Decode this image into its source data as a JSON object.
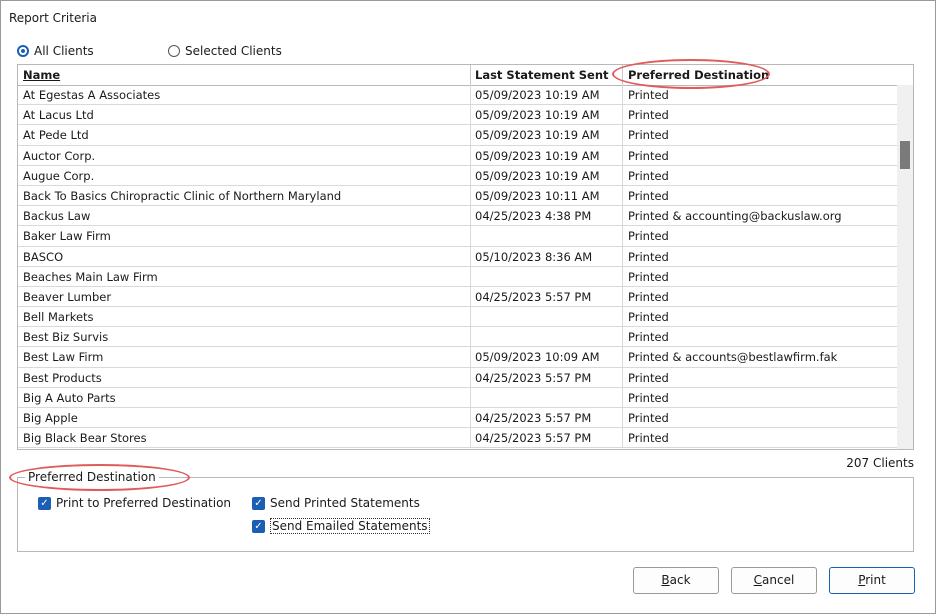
{
  "window": {
    "title": "Report Criteria"
  },
  "client_filter": {
    "options": [
      {
        "label": "All Clients",
        "selected": true
      },
      {
        "label": "Selected Clients",
        "selected": false
      }
    ]
  },
  "grid": {
    "columns": [
      "Name",
      "Last Statement Sent",
      "Preferred Destination"
    ],
    "rows": [
      [
        "At Egestas A Associates",
        "05/09/2023 10:19 AM",
        "Printed"
      ],
      [
        "At Lacus Ltd",
        "05/09/2023 10:19 AM",
        "Printed"
      ],
      [
        "At Pede Ltd",
        "05/09/2023 10:19 AM",
        "Printed"
      ],
      [
        "Auctor Corp.",
        "05/09/2023 10:19 AM",
        "Printed"
      ],
      [
        "Augue Corp.",
        "05/09/2023 10:19 AM",
        "Printed"
      ],
      [
        "Back To Basics Chiropractic Clinic of Northern Maryland",
        "05/09/2023 10:11 AM",
        "Printed"
      ],
      [
        "Backus Law",
        "04/25/2023 4:38 PM",
        "Printed & accounting@backuslaw.org"
      ],
      [
        "Baker Law Firm",
        "",
        "Printed"
      ],
      [
        "BASCO",
        "05/10/2023 8:36 AM",
        "Printed"
      ],
      [
        "Beaches Main Law Firm",
        "",
        "Printed"
      ],
      [
        "Beaver Lumber",
        "04/25/2023 5:57 PM",
        "Printed"
      ],
      [
        "Bell Markets",
        "",
        "Printed"
      ],
      [
        "Best Biz Survis",
        "",
        "Printed"
      ],
      [
        "Best Law Firm",
        "05/09/2023 10:09 AM",
        "Printed & accounts@bestlawfirm.fak"
      ],
      [
        "Best Products",
        "04/25/2023 5:57 PM",
        "Printed"
      ],
      [
        "Big A Auto Parts",
        "",
        "Printed"
      ],
      [
        "Big Apple",
        "04/25/2023 5:57 PM",
        "Printed"
      ],
      [
        "Big Black Bear Stores",
        "04/25/2023 5:57 PM",
        "Printed"
      ]
    ],
    "count_label": "207 Clients"
  },
  "preferred_destination": {
    "title": "Preferred Destination",
    "checkboxes": [
      {
        "label": "Print to Preferred Destination",
        "checked": true
      },
      {
        "label": "Send Printed Statements",
        "checked": true
      },
      {
        "label": "Send Emailed Statements",
        "checked": true
      }
    ]
  },
  "buttons": {
    "back": {
      "mnemonic": "B",
      "rest": "ack"
    },
    "cancel": {
      "mnemonic": "C",
      "rest": "ancel"
    },
    "print": {
      "mnemonic": "P",
      "rest": "rint"
    }
  },
  "colors": {
    "accent": "#1a5fb4",
    "highlight": "#e05a5a"
  }
}
